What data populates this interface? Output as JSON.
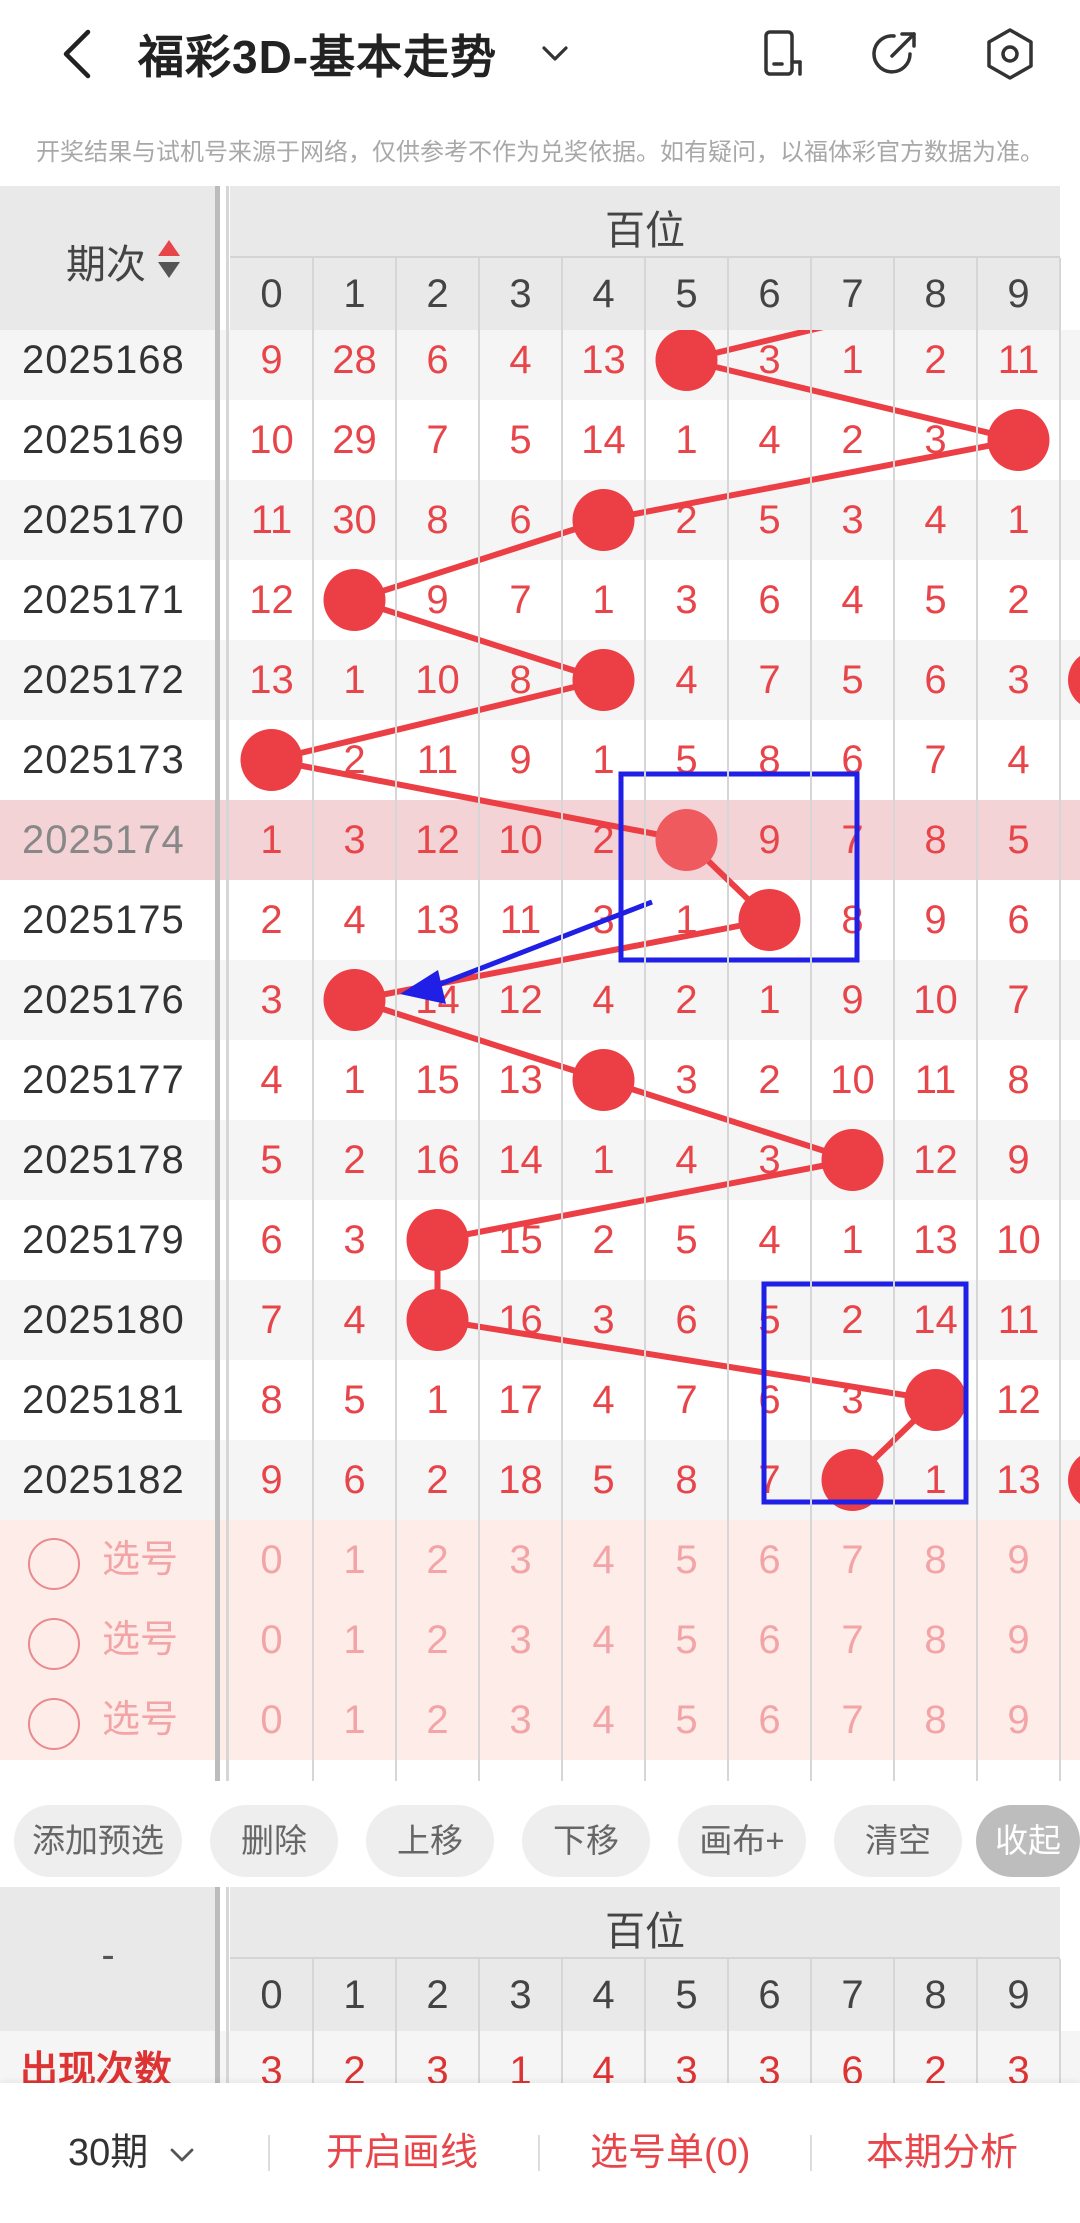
{
  "header": {
    "title": "福彩3D-基本走势"
  },
  "disclaimer": "开奖结果与试机号来源于网络，仅供参考不作为兑奖依据。如有疑问，以福体彩官方数据为准。",
  "table": {
    "period_header": "期次",
    "group_header": "百位",
    "digits": [
      "0",
      "1",
      "2",
      "3",
      "4",
      "5",
      "6",
      "7",
      "8",
      "9"
    ],
    "rows": [
      {
        "period": "2025168",
        "cells": [
          "9",
          "28",
          "6",
          "4",
          "13",
          "5",
          "3",
          "1",
          "2",
          "11"
        ],
        "hit": 5
      },
      {
        "period": "2025169",
        "cells": [
          "10",
          "29",
          "7",
          "5",
          "14",
          "1",
          "4",
          "2",
          "3",
          "9"
        ],
        "hit": 9
      },
      {
        "period": "2025170",
        "cells": [
          "11",
          "30",
          "8",
          "6",
          "4",
          "2",
          "5",
          "3",
          "4",
          "1"
        ],
        "hit": 4
      },
      {
        "period": "2025171",
        "cells": [
          "12",
          "1",
          "9",
          "7",
          "1",
          "3",
          "6",
          "4",
          "5",
          "2"
        ],
        "hit": 1
      },
      {
        "period": "2025172",
        "cells": [
          "13",
          "1",
          "10",
          "8",
          "4",
          "4",
          "7",
          "5",
          "6",
          "3"
        ],
        "hit": 4
      },
      {
        "period": "2025173",
        "cells": [
          "0",
          "2",
          "11",
          "9",
          "1",
          "5",
          "8",
          "6",
          "7",
          "4"
        ],
        "hit": 0
      },
      {
        "period": "2025174",
        "cells": [
          "1",
          "3",
          "12",
          "10",
          "2",
          "5",
          "9",
          "7",
          "8",
          "5"
        ],
        "hit": 5
      },
      {
        "period": "2025175",
        "cells": [
          "2",
          "4",
          "13",
          "11",
          "3",
          "1",
          "6",
          "8",
          "9",
          "6"
        ],
        "hit": 6
      },
      {
        "period": "2025176",
        "cells": [
          "3",
          "1",
          "14",
          "12",
          "4",
          "2",
          "1",
          "9",
          "10",
          "7"
        ],
        "hit": 1
      },
      {
        "period": "2025177",
        "cells": [
          "4",
          "1",
          "15",
          "13",
          "4",
          "3",
          "2",
          "10",
          "11",
          "8"
        ],
        "hit": 4
      },
      {
        "period": "2025178",
        "cells": [
          "5",
          "2",
          "16",
          "14",
          "1",
          "4",
          "3",
          "7",
          "12",
          "9"
        ],
        "hit": 7
      },
      {
        "period": "2025179",
        "cells": [
          "6",
          "3",
          "2",
          "15",
          "2",
          "5",
          "4",
          "1",
          "13",
          "10"
        ],
        "hit": 2
      },
      {
        "period": "2025180",
        "cells": [
          "7",
          "4",
          "2",
          "16",
          "3",
          "6",
          "5",
          "2",
          "14",
          "11"
        ],
        "hit": 2
      },
      {
        "period": "2025181",
        "cells": [
          "8",
          "5",
          "1",
          "17",
          "4",
          "7",
          "6",
          "3",
          "8",
          "12"
        ],
        "hit": 8
      },
      {
        "period": "2025182",
        "cells": [
          "9",
          "6",
          "2",
          "18",
          "5",
          "8",
          "7",
          "7",
          "1",
          "13"
        ],
        "hit": 7
      }
    ],
    "pick_rows": [
      {
        "label": "选号"
      },
      {
        "label": "选号"
      },
      {
        "label": "选号"
      }
    ]
  },
  "toolbar": {
    "buttons": [
      "添加预选",
      "删除",
      "上移",
      "下移",
      "画布+",
      "清空",
      "收起"
    ]
  },
  "stats": {
    "left_label": "-",
    "group_header": "百位",
    "digits": [
      "0",
      "1",
      "2",
      "3",
      "4",
      "5",
      "6",
      "7",
      "8",
      "9"
    ],
    "row_label": "出现次数",
    "counts": [
      "3",
      "2",
      "3",
      "1",
      "4",
      "3",
      "3",
      "6",
      "2",
      "3"
    ]
  },
  "bottombar": {
    "period_select": "30期",
    "draw_line": "开启画线",
    "pick_list": "选号单(0)",
    "analysis": "本期分析"
  },
  "colors": {
    "accent_red": "#e8454a",
    "ball_red": "#ec3f45",
    "annotation_blue": "#1f1fe6"
  }
}
